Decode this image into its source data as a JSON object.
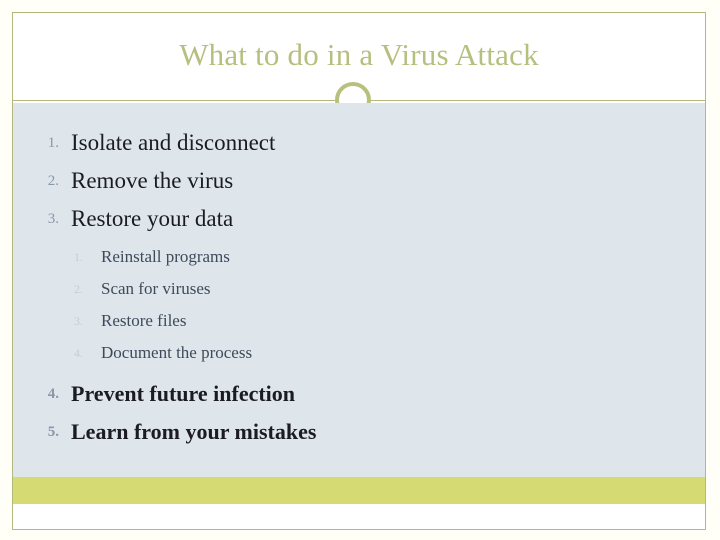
{
  "slide": {
    "title": "What to do in a Virus Attack",
    "colors": {
      "title": "#b7bf7f",
      "frame_border": "#b3b97e",
      "ornament_ring": "#b9c07e",
      "content_background": "#dee6ec",
      "footer_band": "#d5db72",
      "body_text": "#1b1b21",
      "sub_text": "#3e4a59",
      "number_lvl1": "#8a97a8",
      "number_lvl2": "#c3ced6",
      "page_background": "#fffef7"
    },
    "ornament": "circle-outline",
    "list_top": [
      {
        "number": "1.",
        "label": "Isolate and disconnect"
      },
      {
        "number": "2.",
        "label": "Remove the virus"
      },
      {
        "number": "3.",
        "label": "Restore your data"
      }
    ],
    "sublist": [
      {
        "number": "1.",
        "label": "Reinstall programs"
      },
      {
        "number": "2.",
        "label": "Scan for viruses"
      },
      {
        "number": "3.",
        "label": "Restore files"
      },
      {
        "number": "4.",
        "label": "Document the process"
      }
    ],
    "list_bottom": [
      {
        "number": "4.",
        "label": "Prevent future infection"
      },
      {
        "number": "5.",
        "label": "Learn from your mistakes"
      }
    ]
  }
}
